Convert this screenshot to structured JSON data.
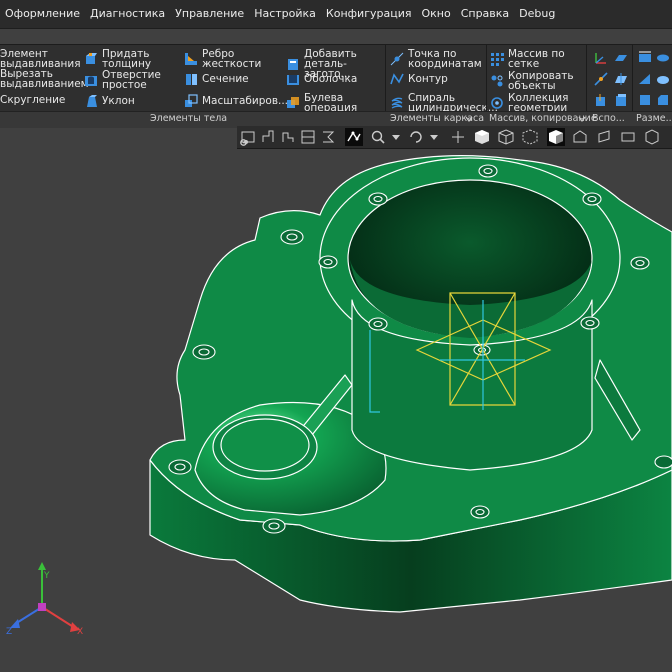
{
  "menu": [
    "Оформление",
    "Диагностика",
    "Управление",
    "Настройка",
    "Конфигурация",
    "Окно",
    "Справка",
    "Debug"
  ],
  "ribbon": {
    "body_elements": {
      "extrude": "Элемент выдавливания",
      "cut_extrude": "Вырезать выдавливанием",
      "fillet": "Скругление",
      "thicken": "Придать толщину",
      "hole_simple": "Отверстие простое",
      "draft": "Уклон",
      "rib": "Ребро жесткости",
      "section": "Сечение",
      "scale": "Масштабиров...",
      "add_blank": "Добавить деталь-загото...",
      "shell": "Оболочка",
      "boolean": "Булева операция"
    },
    "wireframe": {
      "point_coords": "Точка по координатам",
      "contour": "Контур",
      "helix": "Спираль цилиндрическ..."
    },
    "arrays": {
      "grid_array": "Массив по сетке",
      "copy_objects": "Копировать объекты",
      "geometry_collection": "Коллекция геометрии"
    },
    "group_labels": {
      "body": "Элементы тела",
      "wireframe": "Элементы каркаса",
      "arrays": "Массив, копирование",
      "aux": "Вспо...",
      "dims": "Разме..."
    }
  },
  "axes": {
    "x": "X",
    "y": "Y",
    "z": "Z"
  },
  "colors": {
    "model_green": "#0f8a46",
    "model_dark": "#063d1f",
    "background": "#404040",
    "accent_blue": "#3a8fe0",
    "plane_yellow": "#e5d53a",
    "axis_cyan": "#2fc8e0"
  },
  "icons": [
    "wireframe-view-icon",
    "gear-icon",
    "chair-icon",
    "chair-icon",
    "sketch-icon",
    "constraint-icon",
    "zoom-icon",
    "shaded-cube-icon",
    "wireframe-cube-icon",
    "hidden-lines-icon",
    "section-view-icon",
    "measure-icon",
    "parallel-icon",
    "ruler-icon"
  ]
}
